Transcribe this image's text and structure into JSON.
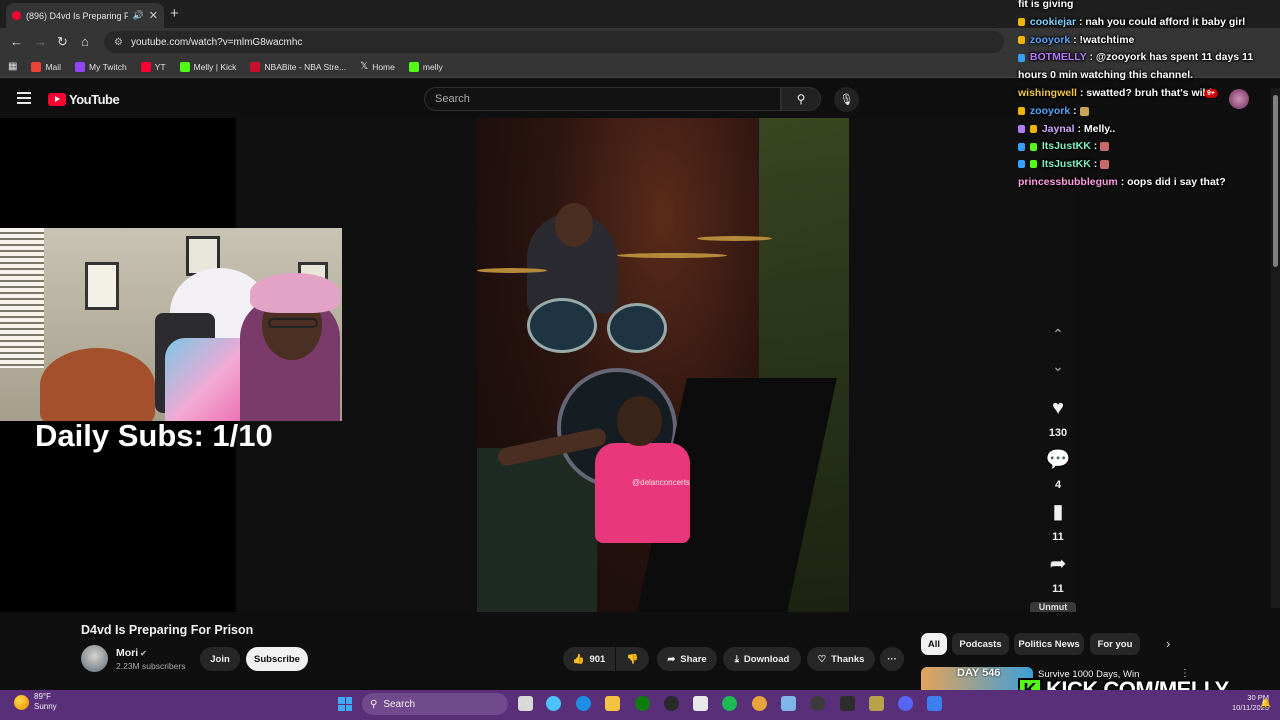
{
  "browser": {
    "tab_title": "(896) D4vd Is Preparing For",
    "url": "youtube.com/watch?v=mlmG8wacmhc",
    "bookmarks": [
      "Mail",
      "My Twitch",
      "YT",
      "Melly | Kick",
      "NBABite - NBA Stre...",
      "Home",
      "melly"
    ]
  },
  "youtube": {
    "logo_text": "YouTube",
    "search_placeholder": "Search",
    "notification_count": "9+"
  },
  "video": {
    "watermark": "@delanconcerts",
    "title": "D4vd Is Preparing For Prison",
    "channel_name": "Mori",
    "channel_subs": "2.23M subscribers",
    "join_label": "Join",
    "subscribe_label": "Subscribe",
    "like_count": "901",
    "share_label": "Share",
    "download_label": "Download",
    "thanks_label": "Thanks",
    "more_label": "···"
  },
  "shorts_actions": {
    "likes": "130",
    "comments": "4",
    "saves": "11",
    "shares": "11",
    "unmute_label": "Unmut"
  },
  "filter_chips": [
    "All",
    "Podcasts",
    "Politics News",
    "For you"
  ],
  "recommendation": {
    "thumb_label": "DAY 546",
    "title": "Survive 1000 Days, Win"
  },
  "overlay": {
    "daily_subs": "Daily Subs: 1/10",
    "kick_url": "KICK.COM/MELLY"
  },
  "chat": [
    {
      "user": "",
      "message": "fit is giving",
      "user_color": "#ffffff"
    },
    {
      "user": "cookiejar",
      "message": ": nah you could afford it baby girl",
      "user_color": "#7fd4ff"
    },
    {
      "user": "zooyork",
      "message": ": !watchtime",
      "user_color": "#53a7ff"
    },
    {
      "user": "BOTMELLY",
      "message": ": @zooyork has spent 11 days 11",
      "user_color": "#b47cff"
    },
    {
      "user": "",
      "message": "hours 0 min watching this channel.",
      "user_color": "#ffffff"
    },
    {
      "user": "wishingwell",
      "message": ": swatted? bruh that's wild",
      "user_color": "#f0c64a"
    },
    {
      "user": "zooyork",
      "message": ":",
      "user_color": "#53a7ff"
    },
    {
      "user": "Jaynal",
      "message": ": Melly..",
      "user_color": "#d3a7ff"
    },
    {
      "user": "ItsJustKK",
      "message": ":",
      "user_color": "#7ef0c0"
    },
    {
      "user": "ItsJustKK",
      "message": ":",
      "user_color": "#7ef0c0"
    },
    {
      "user": "princessbubblegum",
      "message": ": oops did i say that?",
      "user_color": "#ff9fe0"
    }
  ],
  "taskbar": {
    "temperature": "89°F",
    "condition": "Sunny",
    "search_label": "Search",
    "time": "30 PM",
    "date": "10/11/2025"
  },
  "colors": {
    "youtube_red": "#ff0033",
    "kick_green": "#53fc18",
    "taskbar": "#5a2f7a"
  }
}
